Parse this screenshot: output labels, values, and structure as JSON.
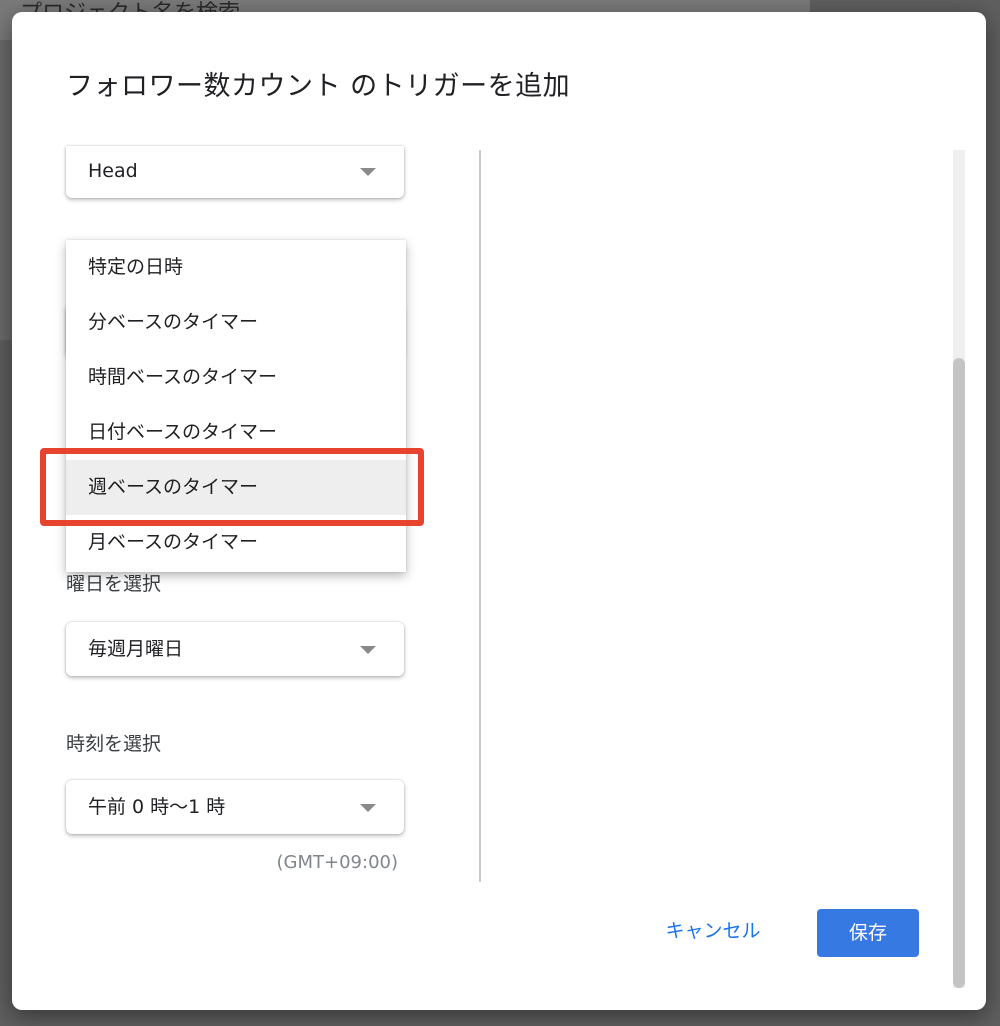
{
  "background": {
    "search_placeholder": "プロジェクト名を検索"
  },
  "dialog": {
    "title": "フォロワー数カウント のトリガーを追加",
    "head_select": {
      "value": "Head"
    },
    "timer_type_menu": {
      "items": [
        {
          "label": "特定の日時"
        },
        {
          "label": "分ベースのタイマー"
        },
        {
          "label": "時間ベースのタイマー"
        },
        {
          "label": "日付ベースのタイマー"
        },
        {
          "label": "週ベースのタイマー"
        },
        {
          "label": "月ベースのタイマー"
        }
      ],
      "selected_index": 4
    },
    "weekday": {
      "label": "曜日を選択",
      "value": "毎週月曜日"
    },
    "time": {
      "label": "時刻を選択",
      "value": "午前 0 時〜1 時",
      "timezone": "(GMT+09:00)"
    },
    "buttons": {
      "cancel": "キャンセル",
      "save": "保存"
    }
  },
  "colors": {
    "highlight": "#e8432e",
    "primary": "#3779e3",
    "link": "#1a73e8"
  },
  "icons": {
    "dropdown": "triangle-down"
  }
}
